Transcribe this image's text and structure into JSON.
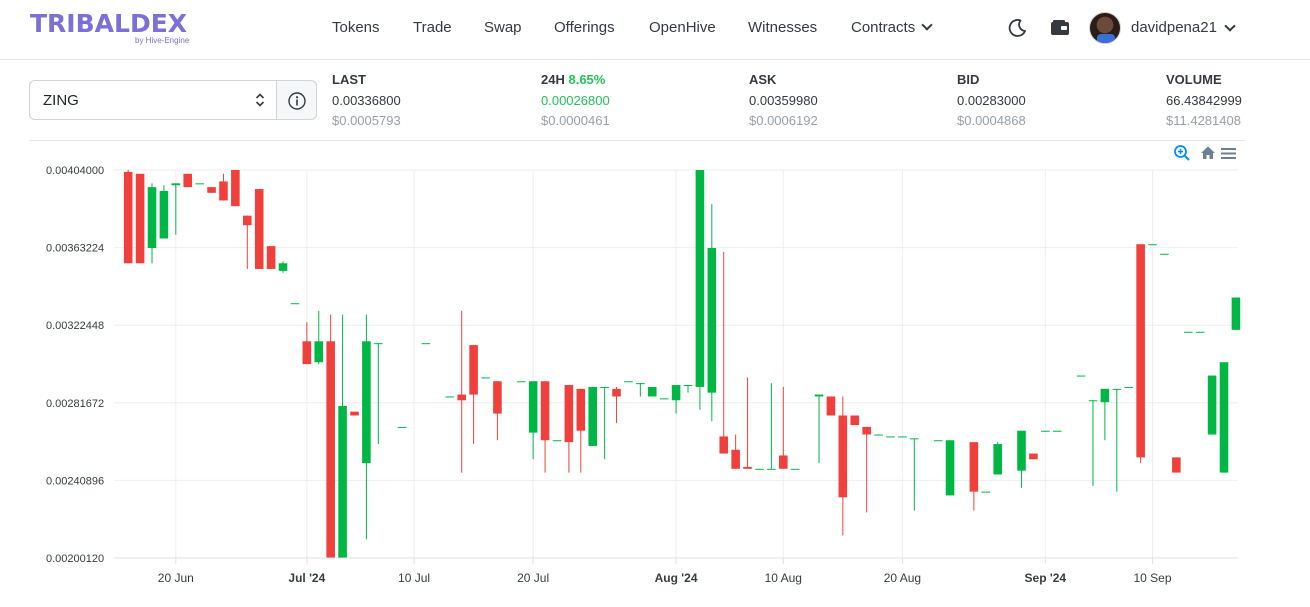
{
  "logo": {
    "main": "TRIBALDEX",
    "sub": "by Hive-Engine"
  },
  "nav": {
    "items": [
      "Tokens",
      "Trade",
      "Swap",
      "Offerings",
      "OpenHive",
      "Witnesses"
    ],
    "contracts": "Contracts"
  },
  "user": {
    "name": "davidpena21"
  },
  "icons": {
    "theme": "moon-icon",
    "wallet": "wallet-icon",
    "info": "info-icon",
    "zoom": "zoom-in-icon",
    "home": "home-icon",
    "menu": "menu-icon"
  },
  "token": {
    "selected": "ZING"
  },
  "stats": {
    "last": {
      "label": "LAST",
      "value": "0.00336800",
      "usd": "$0.0005793"
    },
    "change": {
      "label": "24H",
      "pct": "8.65%",
      "value": "0.00026800",
      "usd": "$0.0000461"
    },
    "ask": {
      "label": "ASK",
      "value": "0.00359980",
      "usd": "$0.0006192"
    },
    "bid": {
      "label": "BID",
      "value": "0.00283000",
      "usd": "$0.0004868"
    },
    "volume": {
      "label": "VOLUME",
      "value": "66.43842999",
      "usd": "$11.4281408"
    }
  },
  "colors": {
    "up": "#00b746",
    "down": "#ef403c",
    "accent": "#7c6fd6",
    "grid": "#eeeeee"
  },
  "chart_data": {
    "type": "candlestick",
    "ylim": [
      0.0020012,
      0.00404
    ],
    "y_ticks": [
      "0.00404000",
      "0.00363224",
      "0.00322448",
      "0.00281672",
      "0.00240896",
      "0.00200120"
    ],
    "x_start": "2024-06-18",
    "x_end": "2024-09-16",
    "x_ticks": [
      {
        "date": "2024-06-20",
        "label": "20 Jun",
        "bold": false
      },
      {
        "date": "2024-07-01",
        "label": "Jul '24",
        "bold": true
      },
      {
        "date": "2024-07-10",
        "label": "10 Jul",
        "bold": false
      },
      {
        "date": "2024-07-20",
        "label": "20 Jul",
        "bold": false
      },
      {
        "date": "2024-08-01",
        "label": "Aug '24",
        "bold": true
      },
      {
        "date": "2024-08-10",
        "label": "10 Aug",
        "bold": false
      },
      {
        "date": "2024-08-20",
        "label": "20 Aug",
        "bold": false
      },
      {
        "date": "2024-09-01",
        "label": "Sep '24",
        "bold": true
      },
      {
        "date": "2024-09-10",
        "label": "10 Sep",
        "bold": false
      }
    ],
    "candles": [
      {
        "date": "2024-06-16",
        "o": 0.00403,
        "h": 0.00404,
        "c": 0.00355,
        "l": 0.00355
      },
      {
        "date": "2024-06-17",
        "o": 0.00402,
        "h": 0.00402,
        "c": 0.00355,
        "l": 0.00355
      },
      {
        "date": "2024-06-18",
        "o": 0.00363,
        "h": 0.00397,
        "c": 0.00395,
        "l": 0.00355
      },
      {
        "date": "2024-06-19",
        "o": 0.00368,
        "h": 0.00396,
        "c": 0.00393,
        "l": 0.00368
      },
      {
        "date": "2024-06-20",
        "o": 0.00396,
        "h": 0.00397,
        "c": 0.00397,
        "l": 0.0037
      },
      {
        "date": "2024-06-21",
        "o": 0.00402,
        "h": 0.00402,
        "c": 0.00395,
        "l": 0.00395
      },
      {
        "date": "2024-06-22",
        "o": 0.00397,
        "h": 0.00397,
        "c": 0.00397,
        "l": 0.00397
      },
      {
        "date": "2024-06-23",
        "o": 0.00395,
        "h": 0.00395,
        "c": 0.00392,
        "l": 0.00392
      },
      {
        "date": "2024-06-24",
        "o": 0.00398,
        "h": 0.00402,
        "c": 0.00388,
        "l": 0.00388
      },
      {
        "date": "2024-06-25",
        "o": 0.00404,
        "h": 0.00404,
        "c": 0.00385,
        "l": 0.00385
      },
      {
        "date": "2024-06-26",
        "o": 0.0038,
        "h": 0.0038,
        "c": 0.00375,
        "l": 0.00352
      },
      {
        "date": "2024-06-27",
        "o": 0.00394,
        "h": 0.00394,
        "c": 0.00352,
        "l": 0.00352
      },
      {
        "date": "2024-06-28",
        "o": 0.00364,
        "h": 0.00364,
        "c": 0.00352,
        "l": 0.00352
      },
      {
        "date": "2024-06-29",
        "o": 0.00351,
        "h": 0.00356,
        "c": 0.00355,
        "l": 0.0035
      },
      {
        "date": "2024-06-30",
        "o": 0.00334,
        "h": 0.00334,
        "c": 0.00334,
        "l": 0.00334
      },
      {
        "date": "2024-07-01",
        "o": 0.00314,
        "h": 0.00324,
        "c": 0.00302,
        "l": 0.00302
      },
      {
        "date": "2024-07-02",
        "o": 0.00303,
        "h": 0.0033,
        "c": 0.00314,
        "l": 0.00302
      },
      {
        "date": "2024-07-03",
        "o": 0.00314,
        "h": 0.00328,
        "c": 0.0020012,
        "l": 0.0020012
      },
      {
        "date": "2024-07-04",
        "o": 0.0020012,
        "h": 0.00328,
        "c": 0.0028,
        "l": 0.0020012
      },
      {
        "date": "2024-07-05",
        "o": 0.00277,
        "h": 0.00277,
        "c": 0.00275,
        "l": 0.00275
      },
      {
        "date": "2024-07-06",
        "o": 0.0025,
        "h": 0.00328,
        "c": 0.00314,
        "l": 0.0021
      },
      {
        "date": "2024-07-07",
        "o": 0.00313,
        "h": 0.00313,
        "c": 0.00313,
        "l": 0.0026
      },
      {
        "date": "2024-07-09",
        "o": 0.00269,
        "h": 0.00269,
        "c": 0.00269,
        "l": 0.00269
      },
      {
        "date": "2024-07-11",
        "o": 0.00313,
        "h": 0.00313,
        "c": 0.00313,
        "l": 0.00313
      },
      {
        "date": "2024-07-13",
        "o": 0.00285,
        "h": 0.00285,
        "c": 0.00285,
        "l": 0.00285
      },
      {
        "date": "2024-07-14",
        "o": 0.00286,
        "h": 0.0033,
        "c": 0.00283,
        "l": 0.00245
      },
      {
        "date": "2024-07-15",
        "o": 0.00312,
        "h": 0.00312,
        "c": 0.00286,
        "l": 0.0026
      },
      {
        "date": "2024-07-16",
        "o": 0.00295,
        "h": 0.00295,
        "c": 0.00295,
        "l": 0.00295
      },
      {
        "date": "2024-07-17",
        "o": 0.00293,
        "h": 0.00293,
        "c": 0.00276,
        "l": 0.00262
      },
      {
        "date": "2024-07-19",
        "o": 0.00293,
        "h": 0.00293,
        "c": 0.00293,
        "l": 0.00293
      },
      {
        "date": "2024-07-20",
        "o": 0.00266,
        "h": 0.00293,
        "c": 0.00293,
        "l": 0.00252
      },
      {
        "date": "2024-07-21",
        "o": 0.00293,
        "h": 0.00293,
        "c": 0.00262,
        "l": 0.00245
      },
      {
        "date": "2024-07-22",
        "o": 0.00262,
        "h": 0.00262,
        "c": 0.00262,
        "l": 0.00262
      },
      {
        "date": "2024-07-23",
        "o": 0.00291,
        "h": 0.00291,
        "c": 0.00261,
        "l": 0.00245
      },
      {
        "date": "2024-07-24",
        "o": 0.00289,
        "h": 0.00289,
        "c": 0.00267,
        "l": 0.00245
      },
      {
        "date": "2024-07-25",
        "o": 0.00259,
        "h": 0.0029,
        "c": 0.0029,
        "l": 0.00259
      },
      {
        "date": "2024-07-26",
        "o": 0.0029,
        "h": 0.0029,
        "c": 0.0029,
        "l": 0.00252
      },
      {
        "date": "2024-07-27",
        "o": 0.00289,
        "h": 0.0029,
        "c": 0.00285,
        "l": 0.00271
      },
      {
        "date": "2024-07-28",
        "o": 0.00293,
        "h": 0.00293,
        "c": 0.00293,
        "l": 0.00293
      },
      {
        "date": "2024-07-29",
        "o": 0.00292,
        "h": 0.00292,
        "c": 0.00292,
        "l": 0.00285
      },
      {
        "date": "2024-07-30",
        "o": 0.00285,
        "h": 0.0029,
        "c": 0.0029,
        "l": 0.00285
      },
      {
        "date": "2024-07-31",
        "o": 0.00284,
        "h": 0.00284,
        "c": 0.00284,
        "l": 0.00284
      },
      {
        "date": "2024-08-01",
        "o": 0.00283,
        "h": 0.00291,
        "c": 0.00291,
        "l": 0.00276
      },
      {
        "date": "2024-08-02",
        "o": 0.00291,
        "h": 0.00291,
        "c": 0.00291,
        "l": 0.00287
      },
      {
        "date": "2024-08-03",
        "o": 0.0029,
        "h": 0.00404,
        "c": 0.00404,
        "l": 0.00278
      },
      {
        "date": "2024-08-04",
        "o": 0.00287,
        "h": 0.00386,
        "c": 0.00363,
        "l": 0.00272
      },
      {
        "date": "2024-08-05",
        "o": 0.00264,
        "h": 0.00361,
        "c": 0.00255,
        "l": 0.00255
      },
      {
        "date": "2024-08-06",
        "o": 0.00257,
        "h": 0.00265,
        "c": 0.00247,
        "l": 0.00247
      },
      {
        "date": "2024-08-07",
        "o": 0.00248,
        "h": 0.00295,
        "c": 0.00247,
        "l": 0.00247
      },
      {
        "date": "2024-08-08",
        "o": 0.00247,
        "h": 0.00247,
        "c": 0.00247,
        "l": 0.00247
      },
      {
        "date": "2024-08-09",
        "o": 0.00247,
        "h": 0.00292,
        "c": 0.00247,
        "l": 0.00247
      },
      {
        "date": "2024-08-10",
        "o": 0.00254,
        "h": 0.0029,
        "c": 0.00247,
        "l": 0.00247
      },
      {
        "date": "2024-08-11",
        "o": 0.00247,
        "h": 0.00247,
        "c": 0.00247,
        "l": 0.00247
      },
      {
        "date": "2024-08-13",
        "o": 0.00285,
        "h": 0.00286,
        "c": 0.00286,
        "l": 0.0025
      },
      {
        "date": "2024-08-14",
        "o": 0.00285,
        "h": 0.00285,
        "c": 0.00275,
        "l": 0.00275
      },
      {
        "date": "2024-08-15",
        "o": 0.00275,
        "h": 0.00285,
        "c": 0.00232,
        "l": 0.00212
      },
      {
        "date": "2024-08-16",
        "o": 0.00275,
        "h": 0.00275,
        "c": 0.0027,
        "l": 0.0027
      },
      {
        "date": "2024-08-17",
        "o": 0.00269,
        "h": 0.00269,
        "c": 0.00265,
        "l": 0.00224
      },
      {
        "date": "2024-08-18",
        "o": 0.00265,
        "h": 0.00265,
        "c": 0.00265,
        "l": 0.00265
      },
      {
        "date": "2024-08-19",
        "o": 0.00264,
        "h": 0.00264,
        "c": 0.00264,
        "l": 0.00264
      },
      {
        "date": "2024-08-20",
        "o": 0.00264,
        "h": 0.00264,
        "c": 0.00264,
        "l": 0.00264
      },
      {
        "date": "2024-08-21",
        "o": 0.00263,
        "h": 0.00263,
        "c": 0.00263,
        "l": 0.00225
      },
      {
        "date": "2024-08-23",
        "o": 0.00262,
        "h": 0.00262,
        "c": 0.00262,
        "l": 0.00262
      },
      {
        "date": "2024-08-24",
        "o": 0.00233,
        "h": 0.00262,
        "c": 0.00262,
        "l": 0.00233
      },
      {
        "date": "2024-08-26",
        "o": 0.00261,
        "h": 0.00261,
        "c": 0.00235,
        "l": 0.00225
      },
      {
        "date": "2024-08-27",
        "o": 0.00235,
        "h": 0.00235,
        "c": 0.00235,
        "l": 0.00235
      },
      {
        "date": "2024-08-28",
        "o": 0.00244,
        "h": 0.00261,
        "c": 0.0026,
        "l": 0.00244
      },
      {
        "date": "2024-08-30",
        "o": 0.00246,
        "h": 0.00267,
        "c": 0.00267,
        "l": 0.00237
      },
      {
        "date": "2024-08-31",
        "o": 0.00255,
        "h": 0.00255,
        "c": 0.00252,
        "l": 0.00252
      },
      {
        "date": "2024-09-01",
        "o": 0.00267,
        "h": 0.00267,
        "c": 0.00267,
        "l": 0.00267
      },
      {
        "date": "2024-09-02",
        "o": 0.00267,
        "h": 0.00267,
        "c": 0.00267,
        "l": 0.00267
      },
      {
        "date": "2024-09-04",
        "o": 0.00296,
        "h": 0.00296,
        "c": 0.00296,
        "l": 0.00296
      },
      {
        "date": "2024-09-05",
        "o": 0.00283,
        "h": 0.00283,
        "c": 0.00283,
        "l": 0.00238
      },
      {
        "date": "2024-09-06",
        "o": 0.00282,
        "h": 0.00289,
        "c": 0.00289,
        "l": 0.00262
      },
      {
        "date": "2024-09-07",
        "o": 0.00289,
        "h": 0.00289,
        "c": 0.00289,
        "l": 0.00235
      },
      {
        "date": "2024-09-08",
        "o": 0.0029,
        "h": 0.0029,
        "c": 0.0029,
        "l": 0.0029
      },
      {
        "date": "2024-09-09",
        "o": 0.00365,
        "h": 0.00365,
        "c": 0.00253,
        "l": 0.0025
      },
      {
        "date": "2024-09-10",
        "o": 0.00365,
        "h": 0.00365,
        "c": 0.00365,
        "l": 0.00365
      },
      {
        "date": "2024-09-11",
        "o": 0.0036,
        "h": 0.0036,
        "c": 0.0036,
        "l": 0.0036
      },
      {
        "date": "2024-09-12",
        "o": 0.00253,
        "h": 0.00253,
        "c": 0.00245,
        "l": 0.00245
      },
      {
        "date": "2024-09-13",
        "o": 0.00319,
        "h": 0.00319,
        "c": 0.00319,
        "l": 0.00319
      },
      {
        "date": "2024-09-14",
        "o": 0.00319,
        "h": 0.00319,
        "c": 0.00319,
        "l": 0.00319
      },
      {
        "date": "2024-09-15",
        "o": 0.00265,
        "h": 0.00296,
        "c": 0.00296,
        "l": 0.00265
      },
      {
        "date": "2024-09-16",
        "o": 0.00245,
        "h": 0.00303,
        "c": 0.00303,
        "l": 0.00245
      },
      {
        "date": "2024-09-17",
        "o": 0.0032,
        "h": 0.00337,
        "c": 0.00337,
        "l": 0.0032
      }
    ]
  }
}
